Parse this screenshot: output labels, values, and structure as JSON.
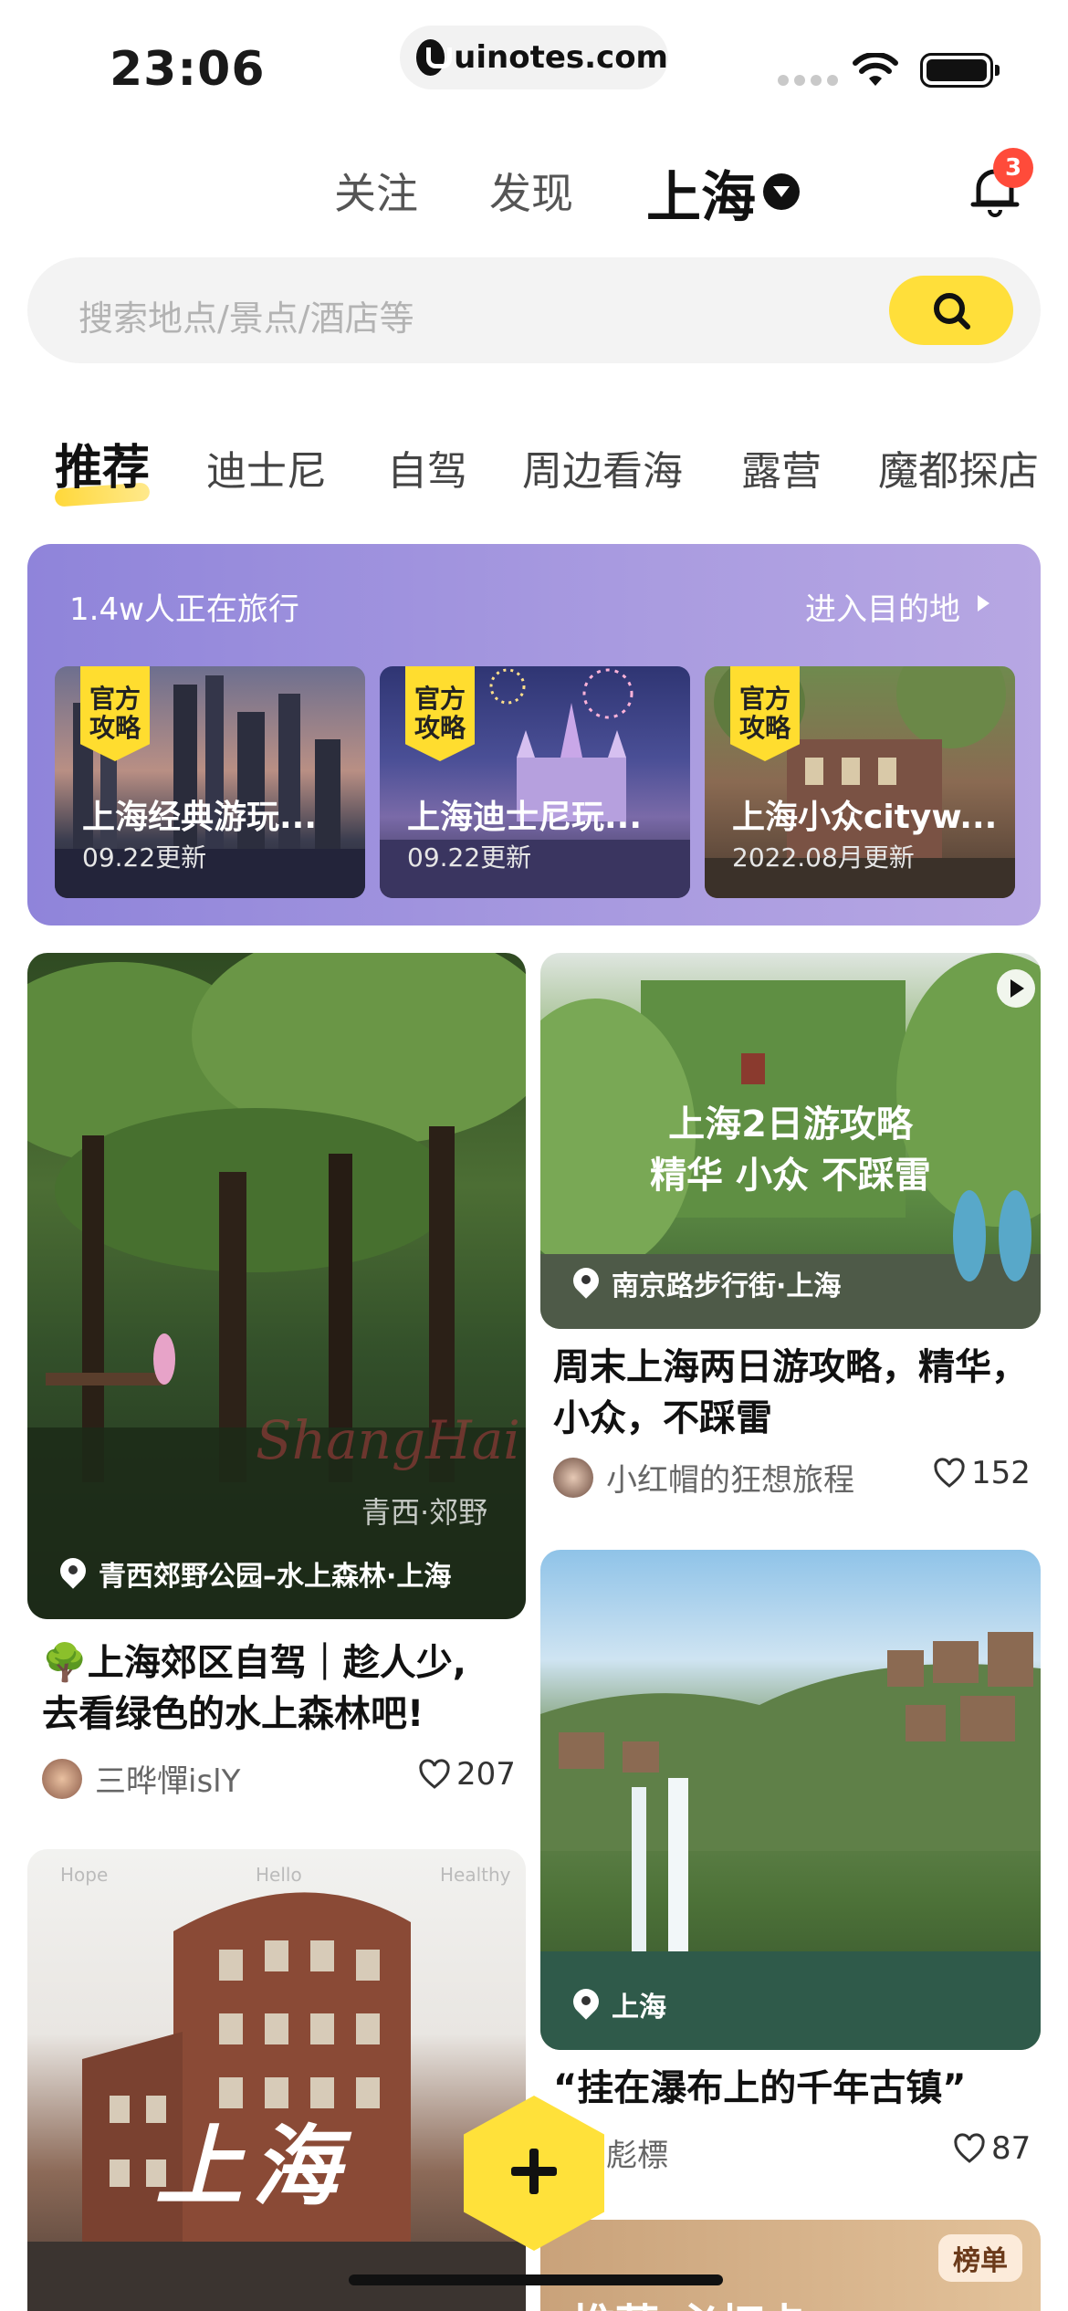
{
  "status_bar": {
    "time": "23:06",
    "url": "uinotes.com"
  },
  "top_nav": {
    "tabs": [
      "关注",
      "发现"
    ],
    "city": "上海",
    "notification_count": "3"
  },
  "search": {
    "placeholder": "搜索地点/景点/酒店等"
  },
  "categories": [
    "推荐",
    "迪士尼",
    "自驾",
    "周边看海",
    "露营",
    "魔都探店"
  ],
  "banner": {
    "travelers_text": "1.4w人正在旅行",
    "enter_label": "进入目的地",
    "tag_line1": "官方",
    "tag_line2": "攻略",
    "cards": [
      {
        "title": "上海经典游玩...",
        "updated": "09.22更新"
      },
      {
        "title": "上海迪士尼玩...",
        "updated": "09.22更新"
      },
      {
        "title": "上海小众cityw...",
        "updated": "2022.08月更新"
      }
    ]
  },
  "feed": {
    "left": [
      {
        "location": "青西郊野公园–水上森林·上海",
        "overlay_script": "ShangHai",
        "overlay_text": "青西·郊野",
        "title": "🌳上海郊区自驾｜趁人少,\n去看绿色的水上森林吧!",
        "author": "三晔憚islY",
        "likes": "207"
      },
      {
        "overlay_text": "上海",
        "corner_left": "Hope",
        "corner_mid": "Hello",
        "corner_right": "Healthy"
      }
    ],
    "right": [
      {
        "location": "南京路步行街·上海",
        "overlay_line1": "上海2日游攻略",
        "overlay_line2": "精华 小众 不踩雷",
        "title": "周末上海两日游攻略，精华，\n小众，不踩雷",
        "author": "小红帽的狂想旅程",
        "likes": "152"
      },
      {
        "location": "上海",
        "title": "“挂在瀑布上的千年古镇”",
        "author": "彪標",
        "likes": "87"
      },
      {
        "badge": "榜单",
        "peek_text": "推荐·必打卡"
      }
    ]
  }
}
